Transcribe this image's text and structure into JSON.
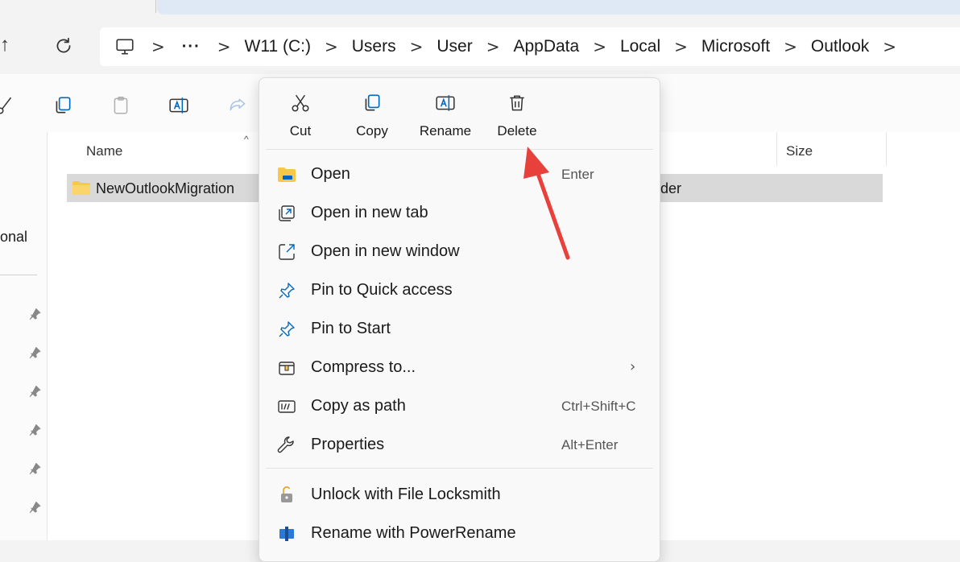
{
  "address_bar": {
    "crumbs": [
      "W11 (C:)",
      "Users",
      "User",
      "AppData",
      "Local",
      "Microsoft",
      "Outlook"
    ],
    "separator": ">",
    "ellipsis": "···"
  },
  "nav": {
    "up_icon": "↑"
  },
  "sidebar": {
    "partial_label": "onal"
  },
  "file_list": {
    "columns": {
      "name": "Name",
      "size": "Size",
      "sort_indicator": "^"
    },
    "rows": [
      {
        "name": "NewOutlookMigration",
        "type_partial": "lder"
      }
    ]
  },
  "context_menu": {
    "quick_actions": [
      {
        "label": "Cut",
        "icon": "scissors-icon"
      },
      {
        "label": "Copy",
        "icon": "copy-icon"
      },
      {
        "label": "Rename",
        "icon": "rename-icon"
      },
      {
        "label": "Delete",
        "icon": "trash-icon"
      }
    ],
    "items": [
      {
        "label": "Open",
        "shortcut": "Enter",
        "icon": "folder-icon"
      },
      {
        "label": "Open in new tab",
        "shortcut": "",
        "icon": "open-new-tab-icon"
      },
      {
        "label": "Open in new window",
        "shortcut": "",
        "icon": "open-new-window-icon"
      },
      {
        "label": "Pin to Quick access",
        "shortcut": "",
        "icon": "pin-icon"
      },
      {
        "label": "Pin to Start",
        "shortcut": "",
        "icon": "pin-icon"
      },
      {
        "label": "Compress to...",
        "shortcut": "",
        "submenu": "›",
        "icon": "zip-icon"
      },
      {
        "label": "Copy as path",
        "shortcut": "Ctrl+Shift+C",
        "icon": "copy-path-icon"
      },
      {
        "label": "Properties",
        "shortcut": "Alt+Enter",
        "icon": "wrench-icon"
      },
      {
        "label": "Unlock with File Locksmith",
        "shortcut": "",
        "icon": "lock-icon"
      },
      {
        "label": "Rename with PowerRename",
        "shortcut": "",
        "icon": "powerrename-icon"
      }
    ]
  },
  "colors": {
    "accent": "#0067c0",
    "annotation_arrow": "#e8413c",
    "selection": "#d9d9d9",
    "folder": "#f7c84a"
  }
}
